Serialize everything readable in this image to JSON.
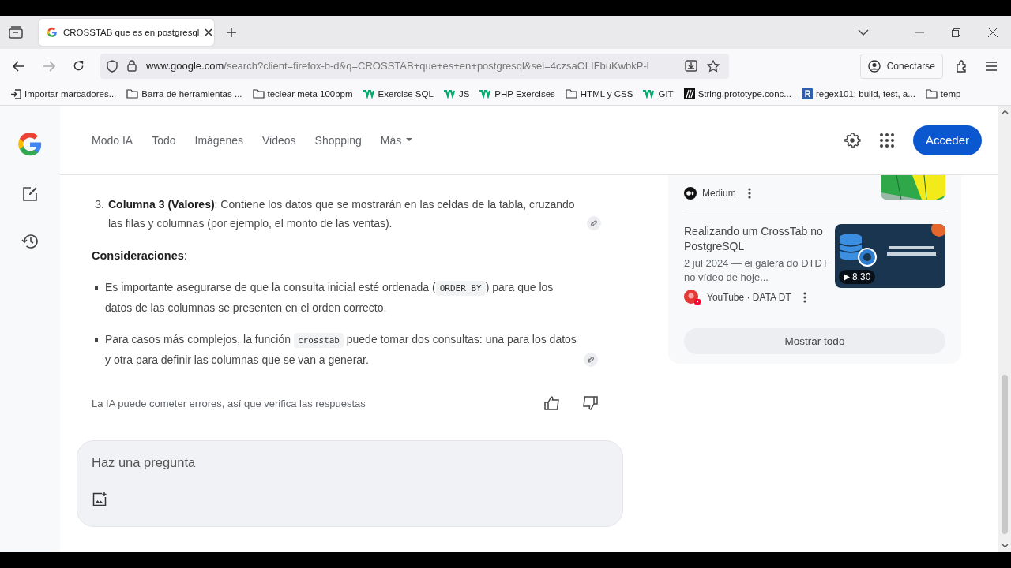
{
  "browser": {
    "tab_title": "CROSSTAB que es en postgresql",
    "url_host": "www.google.com",
    "url_path": "/search?client=firefox-b-d&q=CROSSTAB+que+es+en+postgresql&sei=4czsaOLIFbuKwbkP-l",
    "account_button": "Conectarse",
    "bookmarks": [
      {
        "kind": "import",
        "label": "Importar marcadores..."
      },
      {
        "kind": "folder",
        "label": "Barra de herramientas ..."
      },
      {
        "kind": "folder",
        "label": "teclear meta 100ppm"
      },
      {
        "kind": "w3",
        "label": "Exercise SQL"
      },
      {
        "kind": "w3",
        "label": "JS"
      },
      {
        "kind": "w3",
        "label": "PHP Exercises"
      },
      {
        "kind": "folder",
        "label": "HTML y CSS"
      },
      {
        "kind": "w3",
        "label": "GIT"
      },
      {
        "kind": "mdn",
        "label": "String.prototype.conc..."
      },
      {
        "kind": "regex",
        "label": "regex101: build, test, a..."
      },
      {
        "kind": "folder",
        "label": "temp"
      }
    ]
  },
  "search_nav": {
    "items": [
      "Modo IA",
      "Todo",
      "Imágenes",
      "Videos",
      "Shopping"
    ],
    "more": "Más",
    "sign_in": "Acceder"
  },
  "answer": {
    "numbered_item": {
      "number": "3.",
      "text": "**Columna 3 (Valores)**: Contiene los datos que se mostrarán en las celdas de la tabla, cruzando las filas y columnas (por ejemplo, el monto de las ventas)."
    },
    "heading": "**Consideraciones**:",
    "bullets": [
      [
        {
          "kind": "text",
          "text": "Es importante asegurarse de que la consulta inicial esté ordenada ("
        },
        {
          "kind": "code",
          "text": "ORDER BY"
        },
        {
          "kind": "text",
          "text": ") para que los datos de las columnas se presenten en el orden correcto."
        }
      ],
      [
        {
          "kind": "text",
          "text": "Para casos más complejos, la función "
        },
        {
          "kind": "code",
          "text": "crosstab"
        },
        {
          "kind": "text",
          "text": " puede tomar dos consultas: una para los datos y otra para definir las columnas que se van a generar."
        }
      ]
    ],
    "disclaimer": "La IA puede cometer errores, así que verifica las respuestas",
    "ask_placeholder": "Haz una pregunta"
  },
  "sources": {
    "cards": [
      {
        "kind": "medium",
        "source": "Medium"
      },
      {
        "kind": "youtube",
        "title": "Realizando um CrossTab no PostgreSQL",
        "snippet": "2 jul 2024 — ei galera do DTDT no vídeo de hoje...",
        "source": "YouTube · DATA DT",
        "duration": "8:30"
      }
    ],
    "show_all": "Mostrar todo"
  }
}
